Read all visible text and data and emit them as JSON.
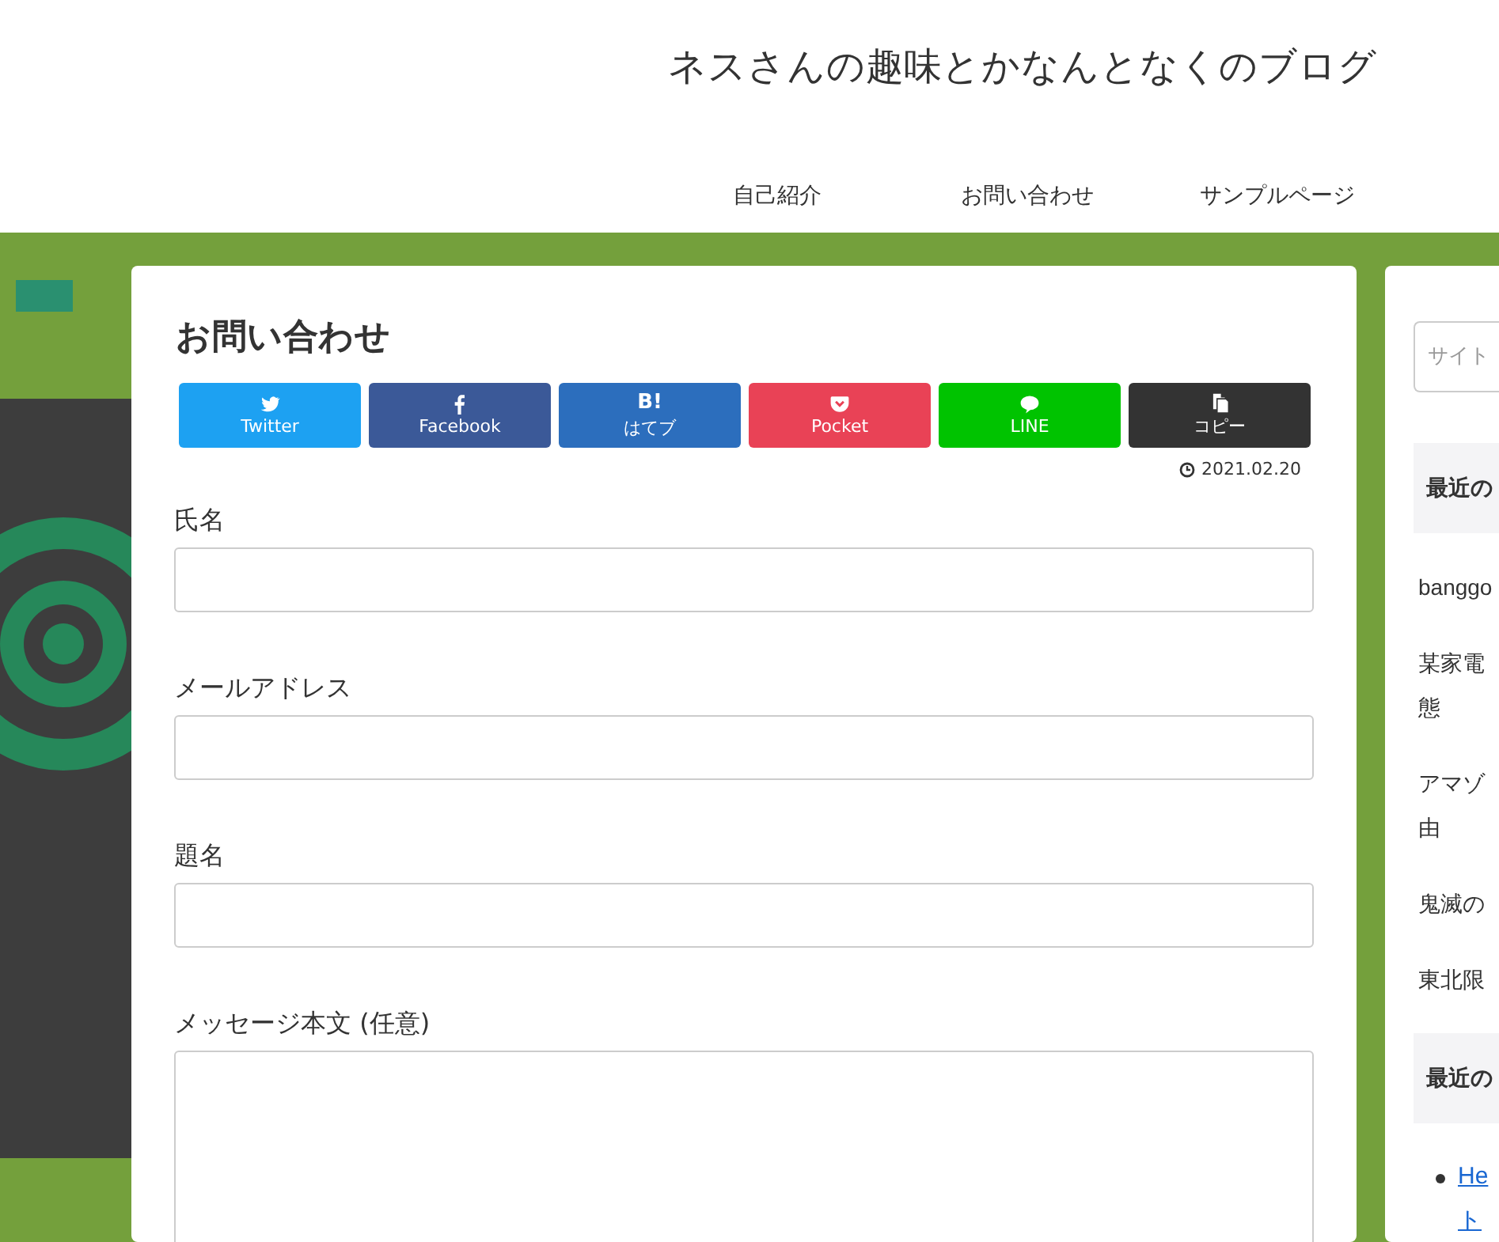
{
  "site_title": "ネスさんの趣味とかなんとなくのブログ",
  "nav": [
    "自己紹介",
    "お問い合わせ",
    "サンプルページ"
  ],
  "page_title": "お問い合わせ",
  "share_buttons": [
    {
      "kind": "twitter",
      "label": "Twitter",
      "color": "#1da1f2"
    },
    {
      "kind": "facebook",
      "label": "Facebook",
      "color": "#3b5998"
    },
    {
      "kind": "hatena",
      "label": "はてブ",
      "glyph": "B!",
      "color": "#2c6ebd"
    },
    {
      "kind": "pocket",
      "label": "Pocket",
      "color": "#e94256"
    },
    {
      "kind": "line",
      "label": "LINE",
      "color": "#00c300"
    },
    {
      "kind": "copy",
      "label": "コピー",
      "color": "#333333"
    }
  ],
  "date": "2021.02.20",
  "fields": [
    {
      "kind": "input",
      "label": "氏名"
    },
    {
      "kind": "input",
      "label": "メールアドレス"
    },
    {
      "kind": "input",
      "label": "題名"
    },
    {
      "kind": "textarea",
      "label": "メッセージ本文 (任意)"
    }
  ],
  "sidebar": {
    "search": {
      "placeholder": "サイト"
    },
    "widgets": [
      {
        "heading": "最近の",
        "kind": "plain",
        "items": [
          [
            "banggo"
          ],
          [
            "某家電",
            "態"
          ],
          [
            "アマゾ",
            "由"
          ],
          [
            "鬼滅の"
          ],
          [
            "東北限"
          ]
        ]
      },
      {
        "heading": "最近の",
        "kind": "links",
        "items": [
          [
            "He",
            "ト"
          ]
        ]
      }
    ]
  }
}
